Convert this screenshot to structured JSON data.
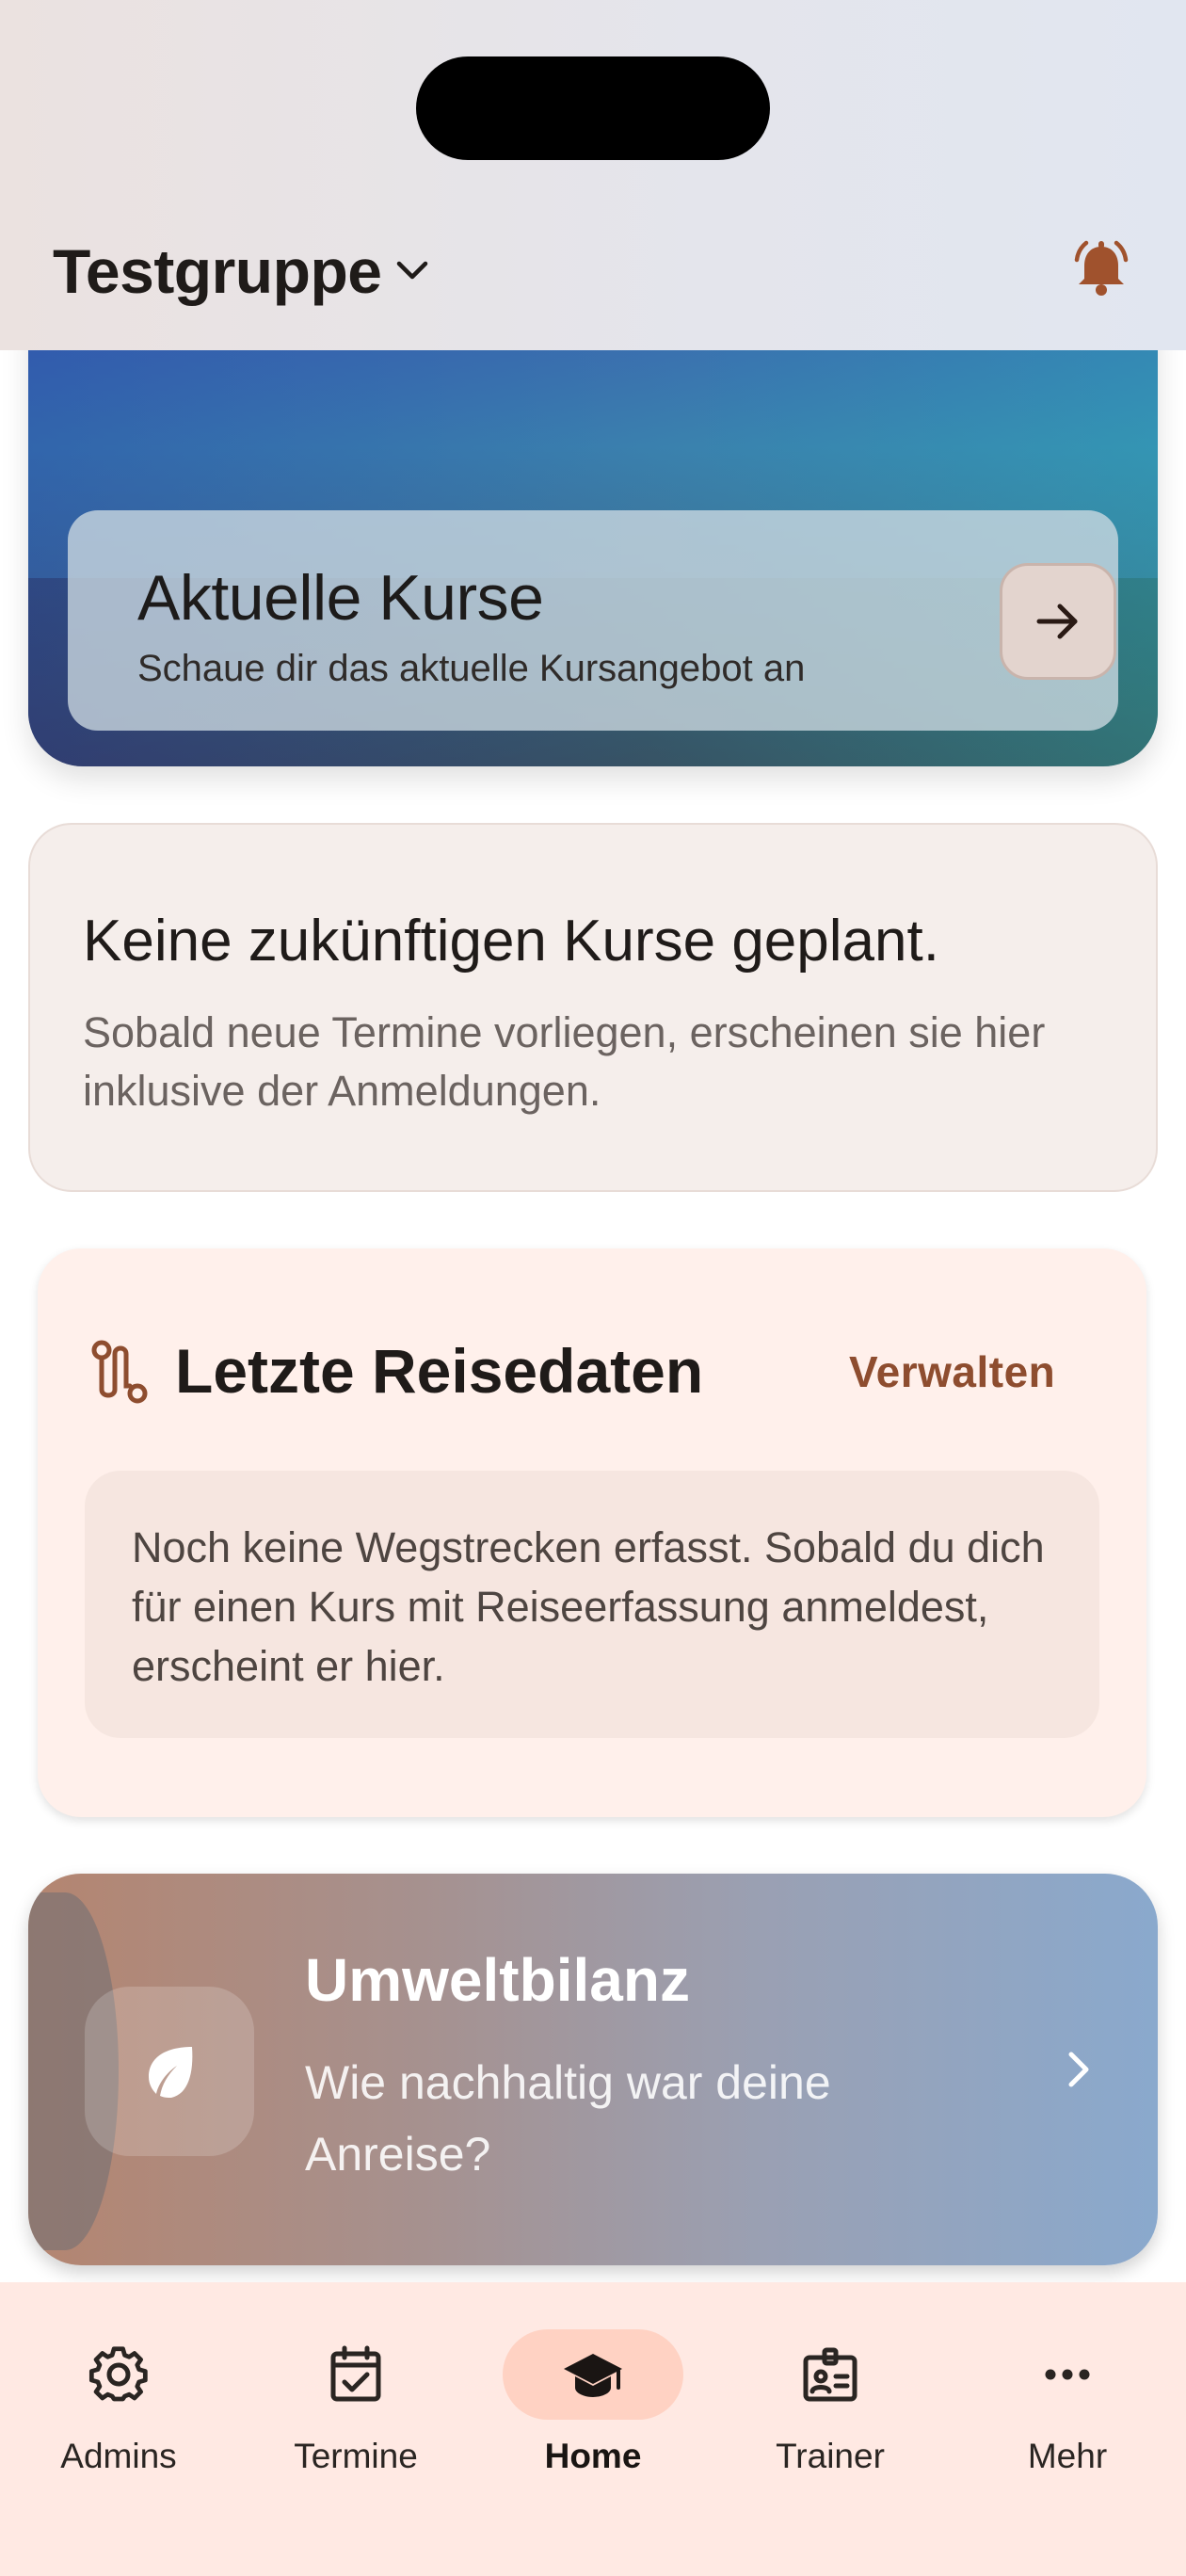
{
  "header": {
    "group_name": "Testgruppe",
    "icons": {
      "dropdown": "chevron-down-icon",
      "notifications": "bell-icon"
    }
  },
  "hero": {
    "title": "Aktuelle Kurse",
    "subtitle": "Schaue dir das aktuelle Kursangebot an",
    "icon": "arrow-right-icon"
  },
  "upcoming": {
    "title": "Keine zukünftigen Kurse geplant.",
    "description": "Sobald neue Termine vorliegen, erscheinen sie hier inklusive der Anmeldungen."
  },
  "travel": {
    "title": "Letzte Reisedaten",
    "manage_label": "Verwalten",
    "empty_text": "Noch keine Wegstrecken erfasst. Sobald du dich für einen Kurs mit Reiseerfassung anmeldest, erscheint er hier.",
    "icon": "route-icon"
  },
  "eco": {
    "title": "Umweltbilanz",
    "subtitle": "Wie nachhaltig war deine Anreise?",
    "icon": "leaf-icon"
  },
  "bottom_nav": {
    "items": [
      {
        "label": "Admins",
        "icon": "gear-icon"
      },
      {
        "label": "Termine",
        "icon": "calendar-check-icon"
      },
      {
        "label": "Home",
        "icon": "graduation-cap-icon",
        "active": true
      },
      {
        "label": "Trainer",
        "icon": "id-badge-icon"
      },
      {
        "label": "Mehr",
        "icon": "more-horizontal-icon"
      }
    ]
  },
  "colors": {
    "accent": "#8e4d2f",
    "bell": "#a0522d",
    "nav_background": "#ffe9e3",
    "nav_active": "#ffd2c3"
  }
}
